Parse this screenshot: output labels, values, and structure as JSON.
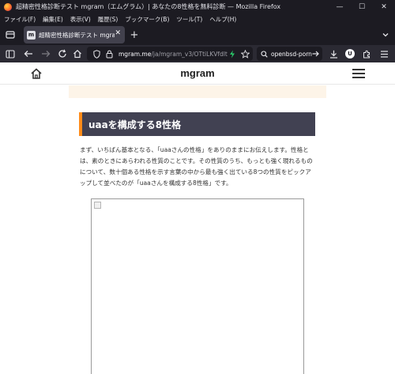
{
  "window": {
    "title": "超精密性格診断テスト mgram（エムグラム）| あなたの8性格を無料診断 — Mozilla Firefox",
    "controls": {
      "minimize": "—",
      "maximize": "☐",
      "close": "✕"
    }
  },
  "menubar": {
    "items": [
      "ファイル(F)",
      "編集(E)",
      "表示(V)",
      "履歴(S)",
      "ブックマーク(B)",
      "ツール(T)",
      "ヘルプ(H)"
    ]
  },
  "tab": {
    "favicon_letter": "m",
    "title": "超精密性格診断テスト mgram（",
    "close": "✕",
    "new_tab": "+"
  },
  "navbar": {
    "url_host": "mgram.me",
    "url_path": "/ja/mgram_v3/OTtiLKVfdlt",
    "search_text": "openbsd-porn",
    "account_letter": "U"
  },
  "page": {
    "logo": "mgram",
    "section_title": "uaaを構成する8性格",
    "paragraph": "まず、いちばん基本となる、「uaaさんの性格」をありのままにお伝えします。性格とは、素のときにあらわれる性質のことです。その性質のうち、もっとも強く現れるものについて、数十個ある性格を示す言葉の中から最も強く出ている8つの性質をピックアップして並べたのが「uaaさんを構成する8性格」です。"
  },
  "colors": {
    "chrome_bg": "#1c1b22",
    "toolbar_bg": "#2b2a33",
    "heading_bg": "#414152",
    "heading_accent": "#ff8c1a",
    "strip_bg": "#fdf4e8"
  }
}
